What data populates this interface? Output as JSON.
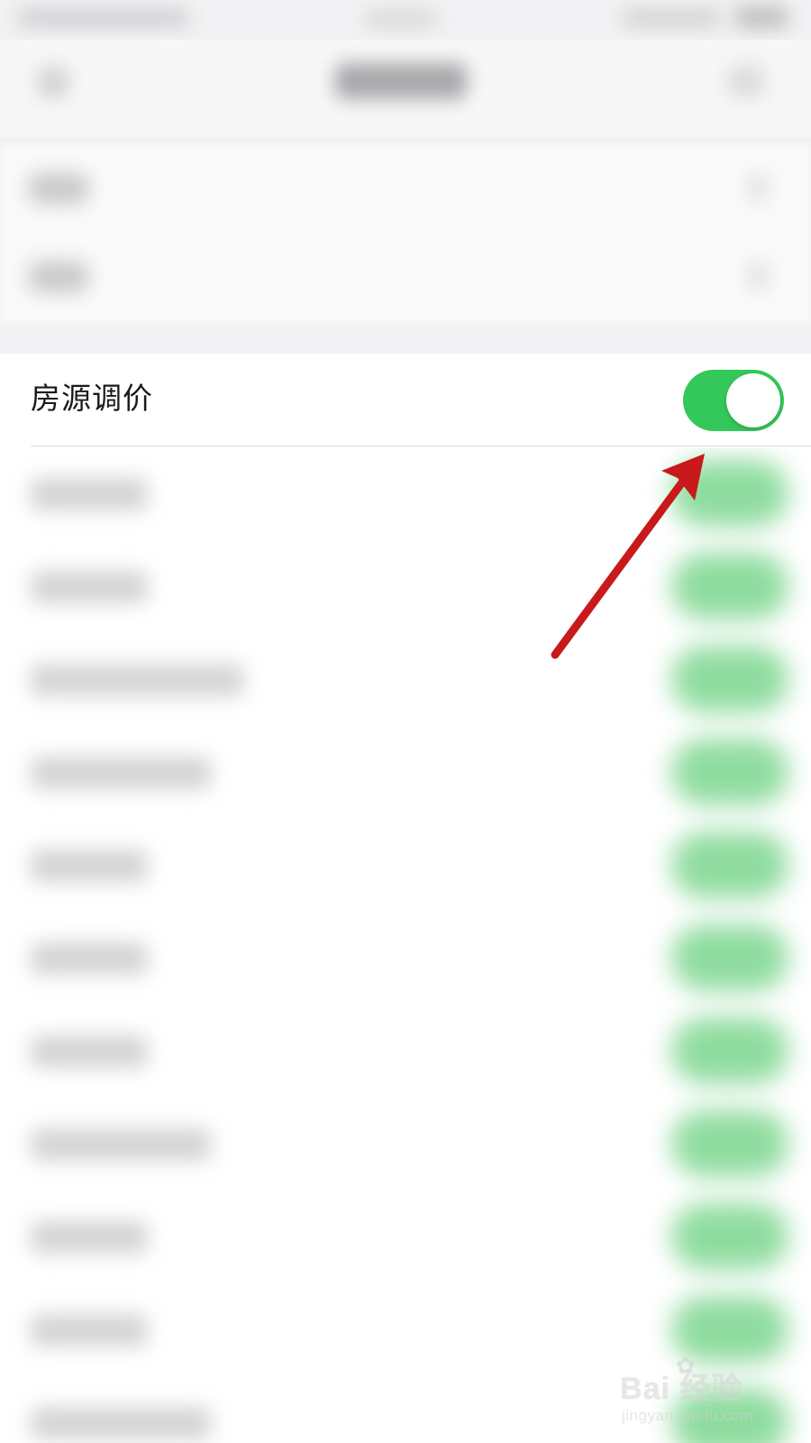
{
  "settings": {
    "price_adjust_label": "房源调价",
    "price_adjust_enabled": true
  },
  "colors": {
    "toggle_on": "#34c759",
    "annotation_arrow": "#c8191b"
  },
  "watermark": {
    "logo_text": "Bai  经验",
    "url": "jingyan.baidu.com"
  }
}
